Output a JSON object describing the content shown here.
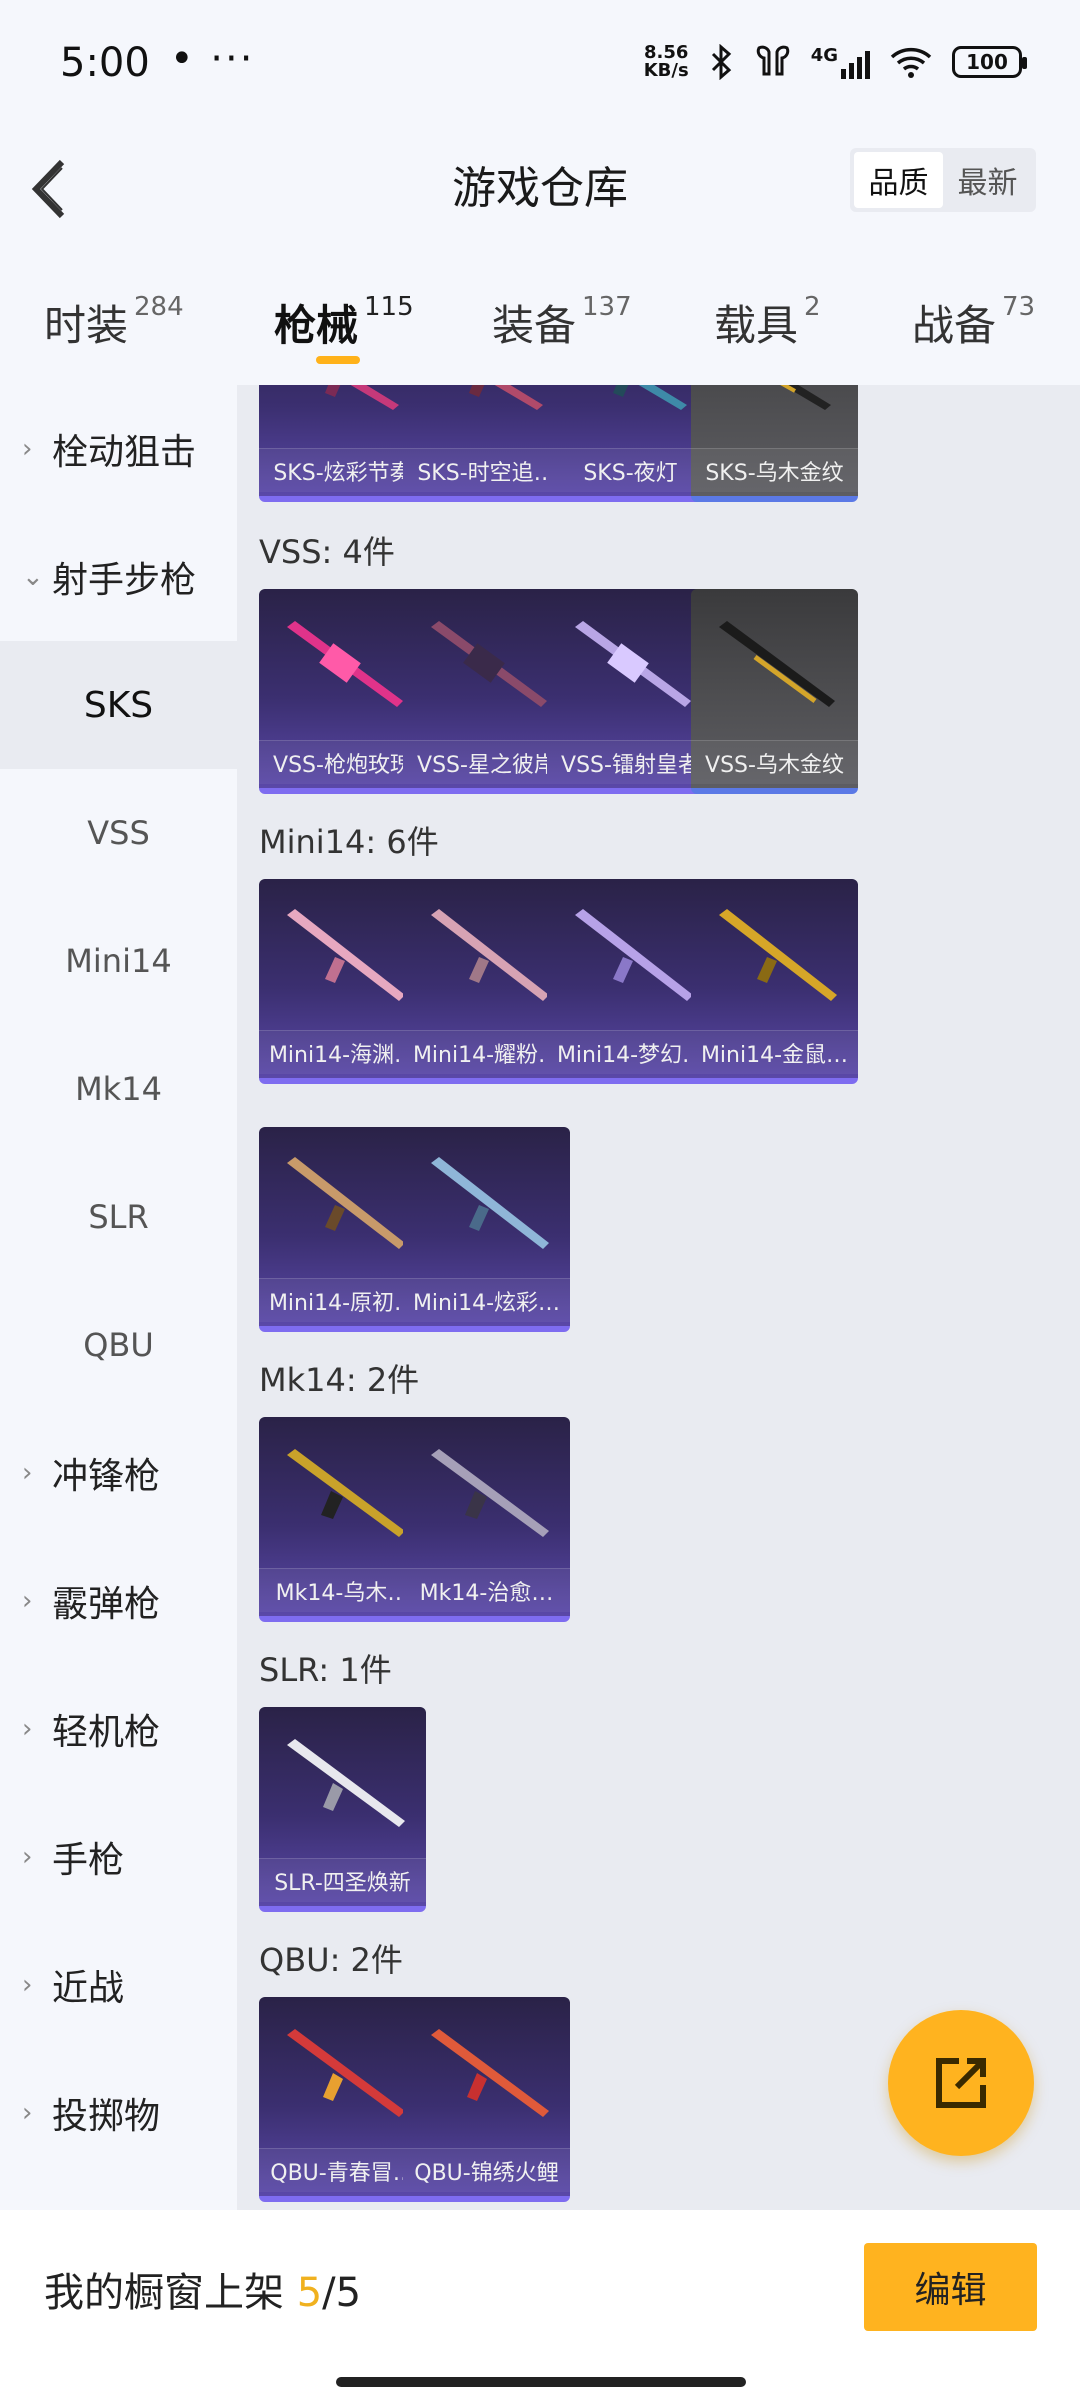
{
  "status": {
    "time": "5:00",
    "dots": "• ···",
    "netspeed_top": "8.56",
    "netspeed_bottom": "KB/s",
    "signal": "4G",
    "battery": "100"
  },
  "header": {
    "title": "游戏仓库",
    "sort_options": [
      "品质",
      "最新"
    ],
    "sort_selected": "品质"
  },
  "tabs": [
    {
      "label": "时装",
      "count": "284"
    },
    {
      "label": "枪械",
      "count": "115",
      "active": true
    },
    {
      "label": "装备",
      "count": "137"
    },
    {
      "label": "载具",
      "count": "2"
    },
    {
      "label": "战备",
      "count": "73"
    }
  ],
  "sidebar": {
    "items": [
      {
        "label": "栓动狙击",
        "type": "group"
      },
      {
        "label": "射手步枪",
        "type": "group-open"
      },
      {
        "label": "SKS",
        "type": "sub",
        "active": true
      },
      {
        "label": "VSS",
        "type": "sub"
      },
      {
        "label": "Mini14",
        "type": "sub"
      },
      {
        "label": "Mk14",
        "type": "sub"
      },
      {
        "label": "SLR",
        "type": "sub"
      },
      {
        "label": "QBU",
        "type": "sub"
      },
      {
        "label": "冲锋枪",
        "type": "group"
      },
      {
        "label": "霰弹枪",
        "type": "group"
      },
      {
        "label": "轻机枪",
        "type": "group"
      },
      {
        "label": "手枪",
        "type": "group"
      },
      {
        "label": "近战",
        "type": "group"
      },
      {
        "label": "投掷物",
        "type": "group"
      }
    ]
  },
  "sections": {
    "sks": {
      "items": [
        "SKS-炫彩节奏",
        "SKS-时空追…",
        "SKS-夜灯",
        "SKS-乌木金纹"
      ]
    },
    "vss": {
      "title": "VSS: 4件",
      "items": [
        "VSS-枪炮玫瑰",
        "VSS-星之彼岸",
        "VSS-镭射皇者",
        "VSS-乌木金纹"
      ]
    },
    "mini14": {
      "title": "Mini14: 6件",
      "items": [
        "Mini14-海渊…",
        "Mini14-耀粉…",
        "Mini14-梦幻…",
        "Mini14-金鼠…",
        "Mini14-原初…",
        "Mini14-炫彩…"
      ]
    },
    "mk14": {
      "title": "Mk14: 2件",
      "items": [
        "Mk14-乌木…",
        "Mk14-治愈…"
      ]
    },
    "slr": {
      "title": "SLR: 1件",
      "items": [
        "SLR-四圣焕新"
      ]
    },
    "qbu": {
      "title": "QBU: 2件",
      "items": [
        "QBU-青春冒…",
        "QBU-锦绣火鲤"
      ]
    }
  },
  "bottom": {
    "showcase_label": "我的橱窗上架",
    "showcase_count": "5",
    "showcase_total": "/5",
    "edit_label": "编辑"
  },
  "colors": {
    "accent": "#ffb31f",
    "card_purple": "#3b2f70",
    "card_grey": "#505053"
  }
}
